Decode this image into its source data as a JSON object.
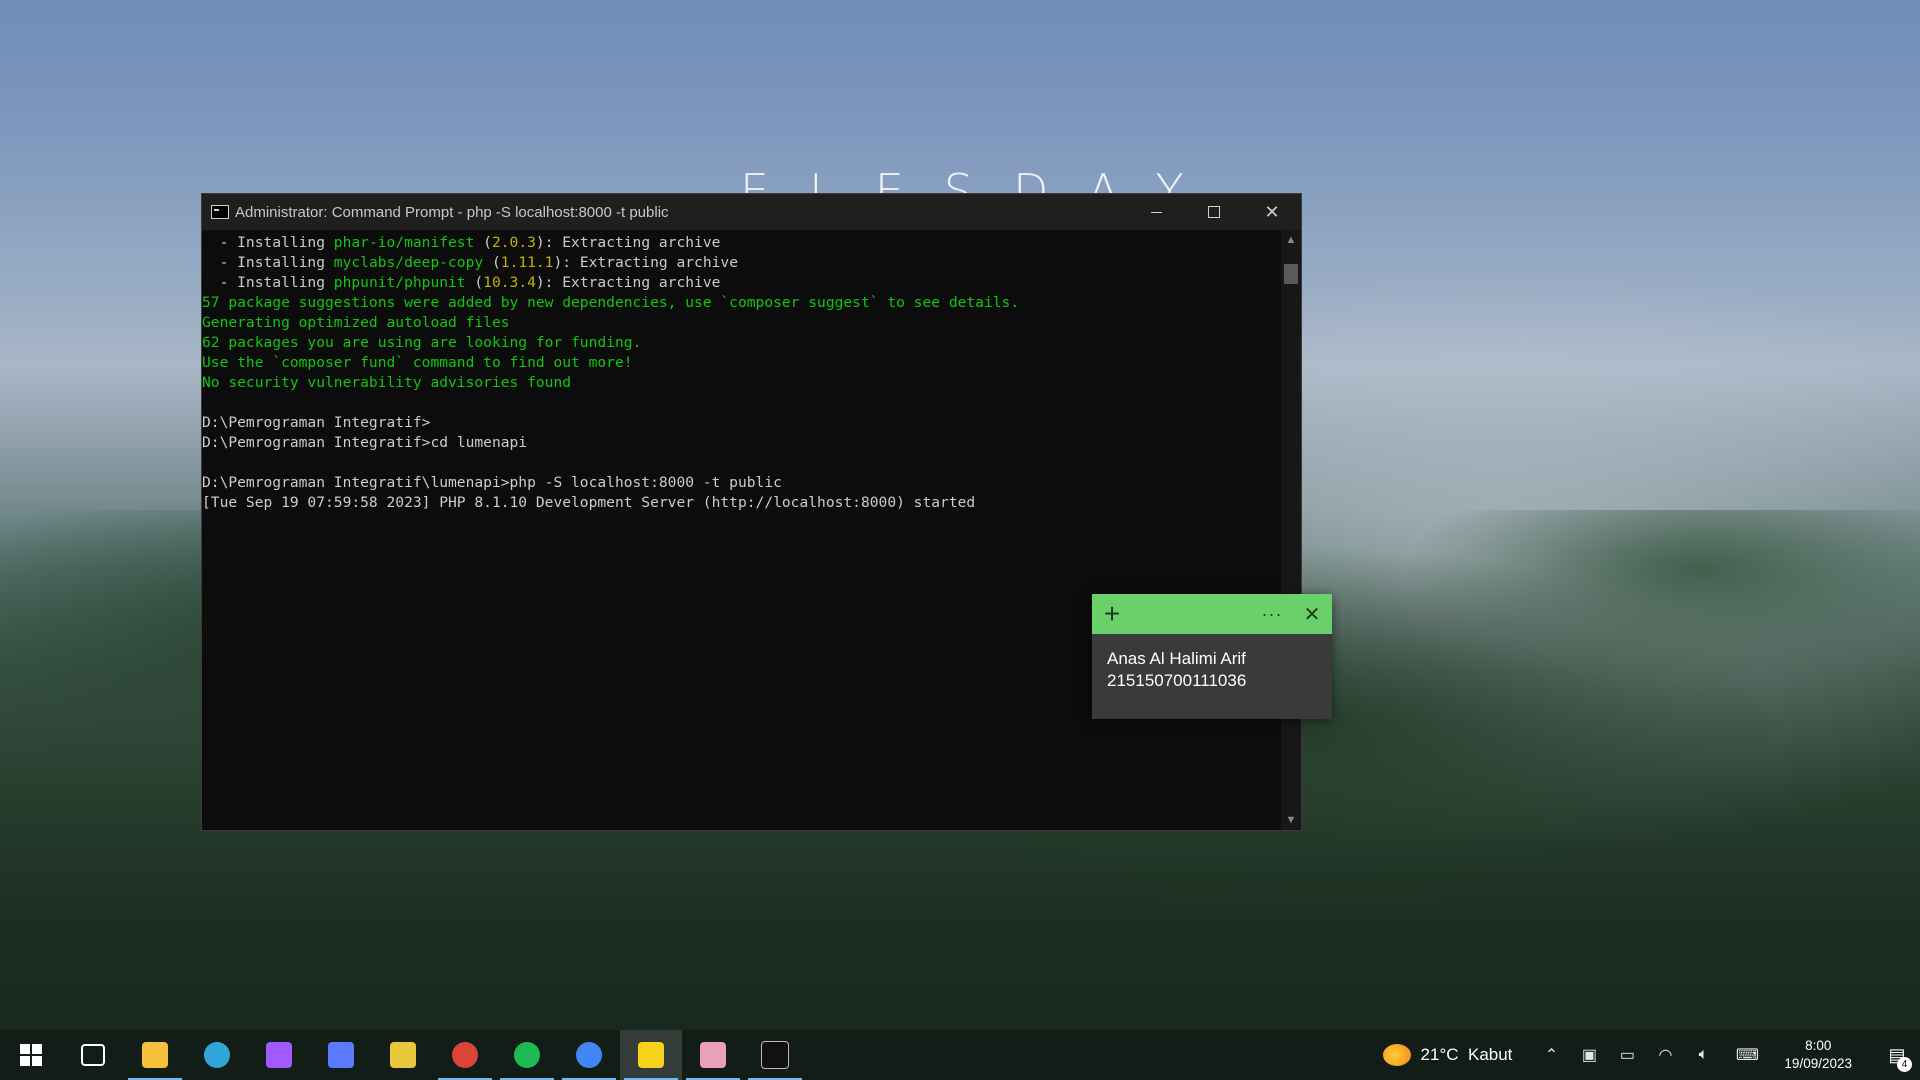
{
  "wallpaper": {
    "text": "ELESDAY"
  },
  "cmd": {
    "title": "Administrator: Command Prompt - php  -S localhost:8000 -t public",
    "lines": [
      [
        {
          "t": "  - Installing ",
          "c": ""
        },
        {
          "t": "phar-io/manifest",
          "c": "g"
        },
        {
          "t": " (",
          "c": ""
        },
        {
          "t": "2.0.3",
          "c": "y"
        },
        {
          "t": "): Extracting archive",
          "c": ""
        }
      ],
      [
        {
          "t": "  - Installing ",
          "c": ""
        },
        {
          "t": "myclabs/deep-copy",
          "c": "g"
        },
        {
          "t": " (",
          "c": ""
        },
        {
          "t": "1.11.1",
          "c": "y"
        },
        {
          "t": "): Extracting archive",
          "c": ""
        }
      ],
      [
        {
          "t": "  - Installing ",
          "c": ""
        },
        {
          "t": "phpunit/phpunit",
          "c": "g"
        },
        {
          "t": " (",
          "c": ""
        },
        {
          "t": "10.3.4",
          "c": "y"
        },
        {
          "t": "): Extracting archive",
          "c": ""
        }
      ],
      [
        {
          "t": "57 package suggestions were added by new dependencies, use `composer suggest` to see details.",
          "c": "g"
        }
      ],
      [
        {
          "t": "Generating optimized autoload files",
          "c": "g"
        }
      ],
      [
        {
          "t": "62 packages you are using are looking for funding.",
          "c": "g"
        }
      ],
      [
        {
          "t": "Use the `composer fund` command to find out more!",
          "c": "g"
        }
      ],
      [
        {
          "t": "No security vulnerability advisories found",
          "c": "g"
        }
      ],
      [
        {
          "t": "",
          "c": ""
        }
      ],
      [
        {
          "t": "D:\\Pemrograman Integratif>",
          "c": ""
        }
      ],
      [
        {
          "t": "D:\\Pemrograman Integratif>cd lumenapi",
          "c": ""
        }
      ],
      [
        {
          "t": "",
          "c": ""
        }
      ],
      [
        {
          "t": "D:\\Pemrograman Integratif\\lumenapi>php -S localhost:8000 -t public",
          "c": ""
        }
      ],
      [
        {
          "t": "[Tue Sep 19 07:59:58 2023] PHP 8.1.10 Development Server (http://localhost:8000) started",
          "c": ""
        }
      ]
    ]
  },
  "sticky": {
    "add": "+",
    "more": "···",
    "close": "✕",
    "line1": "Anas Al Halimi Arif",
    "line2": "215150700111036"
  },
  "taskbar": {
    "weather_temp": "21°C",
    "weather_desc": "Kabut",
    "time": "8:00",
    "date": "19/09/2023",
    "notification_count": "4",
    "apps": [
      {
        "name": "task-view",
        "color": "#ffffff",
        "running": false,
        "active": false
      },
      {
        "name": "file-explorer",
        "color": "#f3c23a",
        "running": true,
        "active": false
      },
      {
        "name": "edge",
        "color": "#2fa6d8",
        "running": false,
        "active": false
      },
      {
        "name": "figma",
        "color": "#a259ff",
        "running": false,
        "active": false
      },
      {
        "name": "copilot",
        "color": "#5a7bff",
        "running": false,
        "active": false
      },
      {
        "name": "starred-app",
        "color": "#e8c83a",
        "running": false,
        "active": false
      },
      {
        "name": "chrome-dev",
        "color": "#db4437",
        "running": true,
        "active": false
      },
      {
        "name": "spotify",
        "color": "#1db954",
        "running": true,
        "active": false
      },
      {
        "name": "chrome",
        "color": "#4285f4",
        "running": true,
        "active": false
      },
      {
        "name": "sticky-notes",
        "color": "#f7d21b",
        "running": true,
        "active": true
      },
      {
        "name": "anime-app",
        "color": "#e9a0b8",
        "running": true,
        "active": false
      },
      {
        "name": "command-prompt",
        "color": "#111111",
        "running": true,
        "active": false
      }
    ]
  }
}
